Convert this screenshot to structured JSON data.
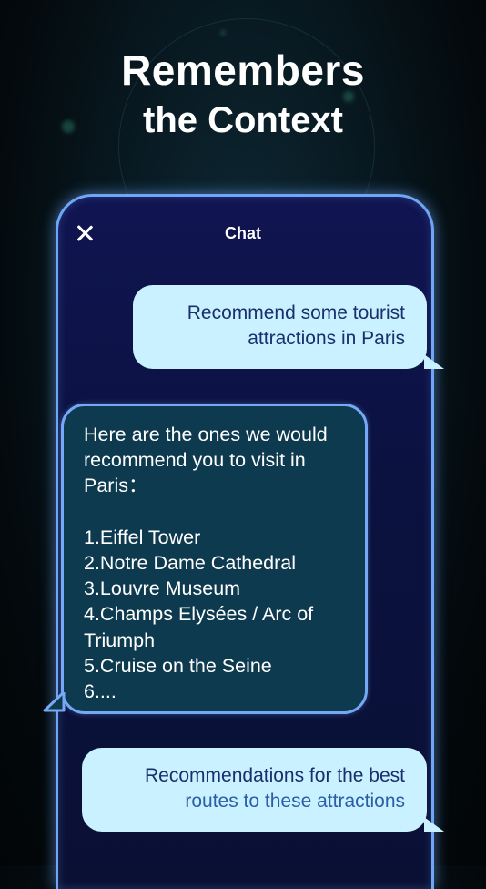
{
  "headline": {
    "line1": "Remembers",
    "line2": "the Context"
  },
  "chat": {
    "title": "Chat",
    "messages": [
      {
        "role": "user",
        "line1": "Recommend some tourist",
        "line2": "attractions in Paris"
      },
      {
        "role": "assistant",
        "text": "Here are the ones we would\nrecommend you to visit in\nParis：\n\n1.Eiffel Tower\n2.Notre Dame Cathedral\n3.Louvre Museum\n4.Champs Elysées / Arc of\nTriumph\n5.Cruise on the Seine\n6...."
      },
      {
        "role": "user",
        "line1": "Recommendations for the best",
        "line2": "routes to these attractions"
      }
    ]
  },
  "colors": {
    "accent": "#6fa6f5",
    "user_bubble": "#c9f1ff",
    "user_text": "#1a2f6e",
    "ai_bubble": "#0e3a4f"
  },
  "icons": {
    "close": "close-icon"
  }
}
